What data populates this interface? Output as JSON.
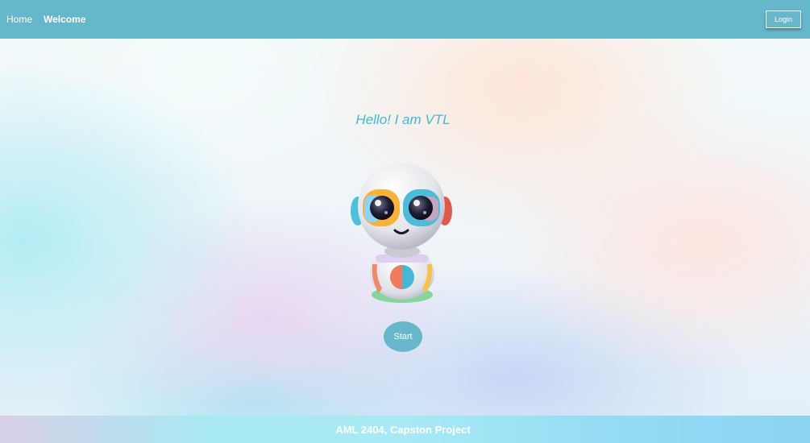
{
  "nav": {
    "links": [
      {
        "label": "Home"
      },
      {
        "label": "Welcome"
      }
    ],
    "login_label": "Login"
  },
  "hero": {
    "greeting": "Hello! I am VTL",
    "start_label": "Start"
  },
  "footer": {
    "text": "AML 2404, Capston Project"
  },
  "icons": {
    "robot": "robot-mascot-image"
  },
  "colors": {
    "navbar": "#67b7cb",
    "greeting": "#45b8cf",
    "start_button": "#68b6c9"
  }
}
